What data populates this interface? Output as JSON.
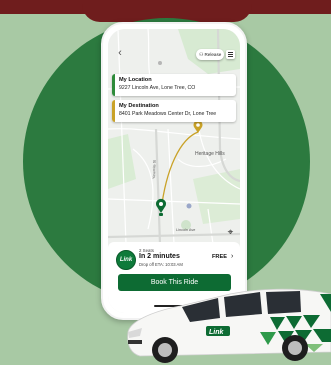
{
  "app": {
    "release_label": "Release",
    "pickup": {
      "title": "My Location",
      "address": "9227 Lincoln Ave, Lone Tree, CO"
    },
    "destination": {
      "title": "My Destination",
      "address": "8401 Park Meadows Center Dr, Lone Tree"
    },
    "map_labels": {
      "area": "Heritage Hills",
      "street_1": "Lincoln Ave",
      "street_2": "Yosemite St"
    },
    "ride": {
      "logo_text": "Link",
      "seats": "2 Seats",
      "eta": "In 2 minutes",
      "dropoff": "Drop off ETA: 10:03 AM",
      "price": "FREE",
      "book_label": "Book This Ride"
    }
  },
  "vehicle": {
    "logo_text": "Link"
  },
  "colors": {
    "background": "#a8c9a4",
    "top_band": "#6f1d1d",
    "circle": "#2c7a3f",
    "brand_green": "#0d6b33",
    "pickup_stripe": "#2e8b3a",
    "destination_stripe": "#c9a227",
    "route": "#c9a227"
  },
  "icons": [
    "back-arrow-icon",
    "user-icon",
    "menu-icon",
    "pickup-pin-icon",
    "destination-pin-icon",
    "locate-icon",
    "chevron-right-icon",
    "link-logo-icon"
  ]
}
